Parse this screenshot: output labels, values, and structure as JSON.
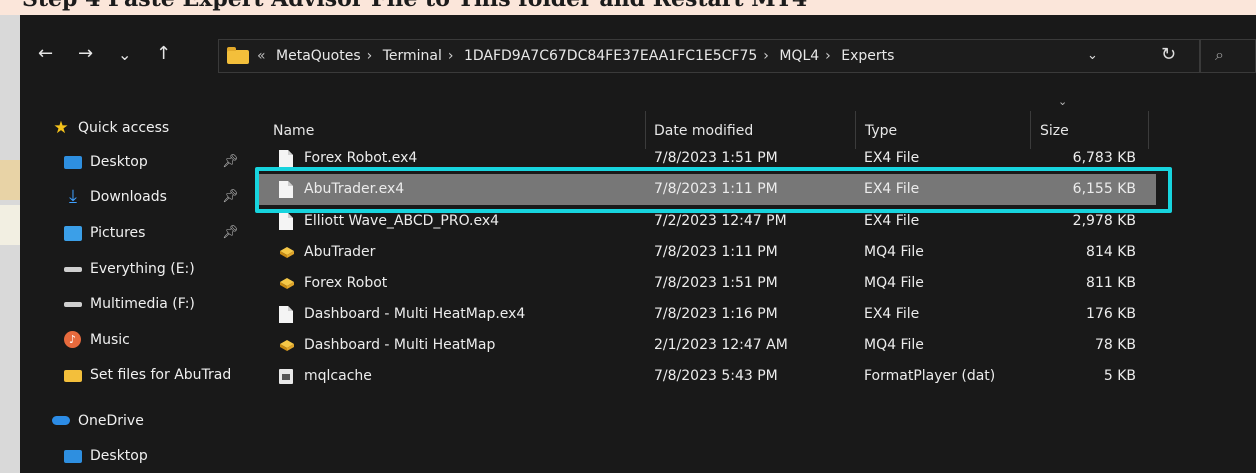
{
  "heading": "Step 4 Paste Expert Advisor File to This folder and Restart MT4",
  "nav": {
    "back": "←",
    "forward": "→",
    "recent": "⌄",
    "up": "↑"
  },
  "address": {
    "overflow": "«",
    "crumbs": [
      "MetaQuotes",
      "Terminal",
      "1DAFD9A7C67DC84FE37EAA1FC1E5CF75",
      "MQL4",
      "Experts"
    ],
    "separator": "›",
    "dropdown": "⌄",
    "refresh": "↻"
  },
  "search_icon": "⌕",
  "sidebar": {
    "items": [
      {
        "label": "Quick access",
        "icon": "star-icon"
      },
      {
        "label": "Desktop",
        "icon": "desktop-icon",
        "pinned": true
      },
      {
        "label": "Downloads",
        "icon": "download-icon",
        "pinned": true
      },
      {
        "label": "Pictures",
        "icon": "pictures-icon",
        "pinned": true
      },
      {
        "label": "Everything (E:)",
        "icon": "drive-icon"
      },
      {
        "label": "Multimedia (F:)",
        "icon": "drive-icon"
      },
      {
        "label": "Music",
        "icon": "music-icon"
      },
      {
        "label": "Set files for AbuTrad",
        "icon": "folder-icon"
      },
      {
        "label": "OneDrive",
        "icon": "cloud-icon"
      },
      {
        "label": "Desktop",
        "icon": "desktop-icon"
      }
    ]
  },
  "columns": {
    "name": "Name",
    "date": "Date modified",
    "type": "Type",
    "size": "Size"
  },
  "files": [
    {
      "name": "Forex Robot.ex4",
      "date": "7/8/2023 1:51 PM",
      "type": "EX4 File",
      "size": "6,783 KB",
      "icon": "file-icon"
    },
    {
      "name": "AbuTrader.ex4",
      "date": "7/8/2023 1:11 PM",
      "type": "EX4 File",
      "size": "6,155 KB",
      "icon": "file-icon"
    },
    {
      "name": "Elliott Wave_ABCD_PRO.ex4",
      "date": "7/2/2023 12:47 PM",
      "type": "EX4 File",
      "size": "2,978 KB",
      "icon": "file-icon"
    },
    {
      "name": "AbuTrader",
      "date": "7/8/2023 1:11 PM",
      "type": "MQ4 File",
      "size": "814 KB",
      "icon": "mq4-icon"
    },
    {
      "name": "Forex Robot",
      "date": "7/8/2023 1:51 PM",
      "type": "MQ4 File",
      "size": "811 KB",
      "icon": "mq4-icon"
    },
    {
      "name": "Dashboard - Multi HeatMap.ex4",
      "date": "7/8/2023 1:16 PM",
      "type": "EX4 File",
      "size": "176 KB",
      "icon": "file-icon"
    },
    {
      "name": "Dashboard - Multi HeatMap",
      "date": "2/1/2023 12:47 AM",
      "type": "MQ4 File",
      "size": "78 KB",
      "icon": "mq4-icon"
    },
    {
      "name": "mqlcache",
      "date": "7/8/2023 5:43 PM",
      "type": "FormatPlayer (dat)",
      "size": "5 KB",
      "icon": "dat-icon"
    }
  ],
  "selected_index": 1,
  "colors": {
    "highlight": "#17d4de",
    "selection": "#777777",
    "background": "#191919"
  }
}
